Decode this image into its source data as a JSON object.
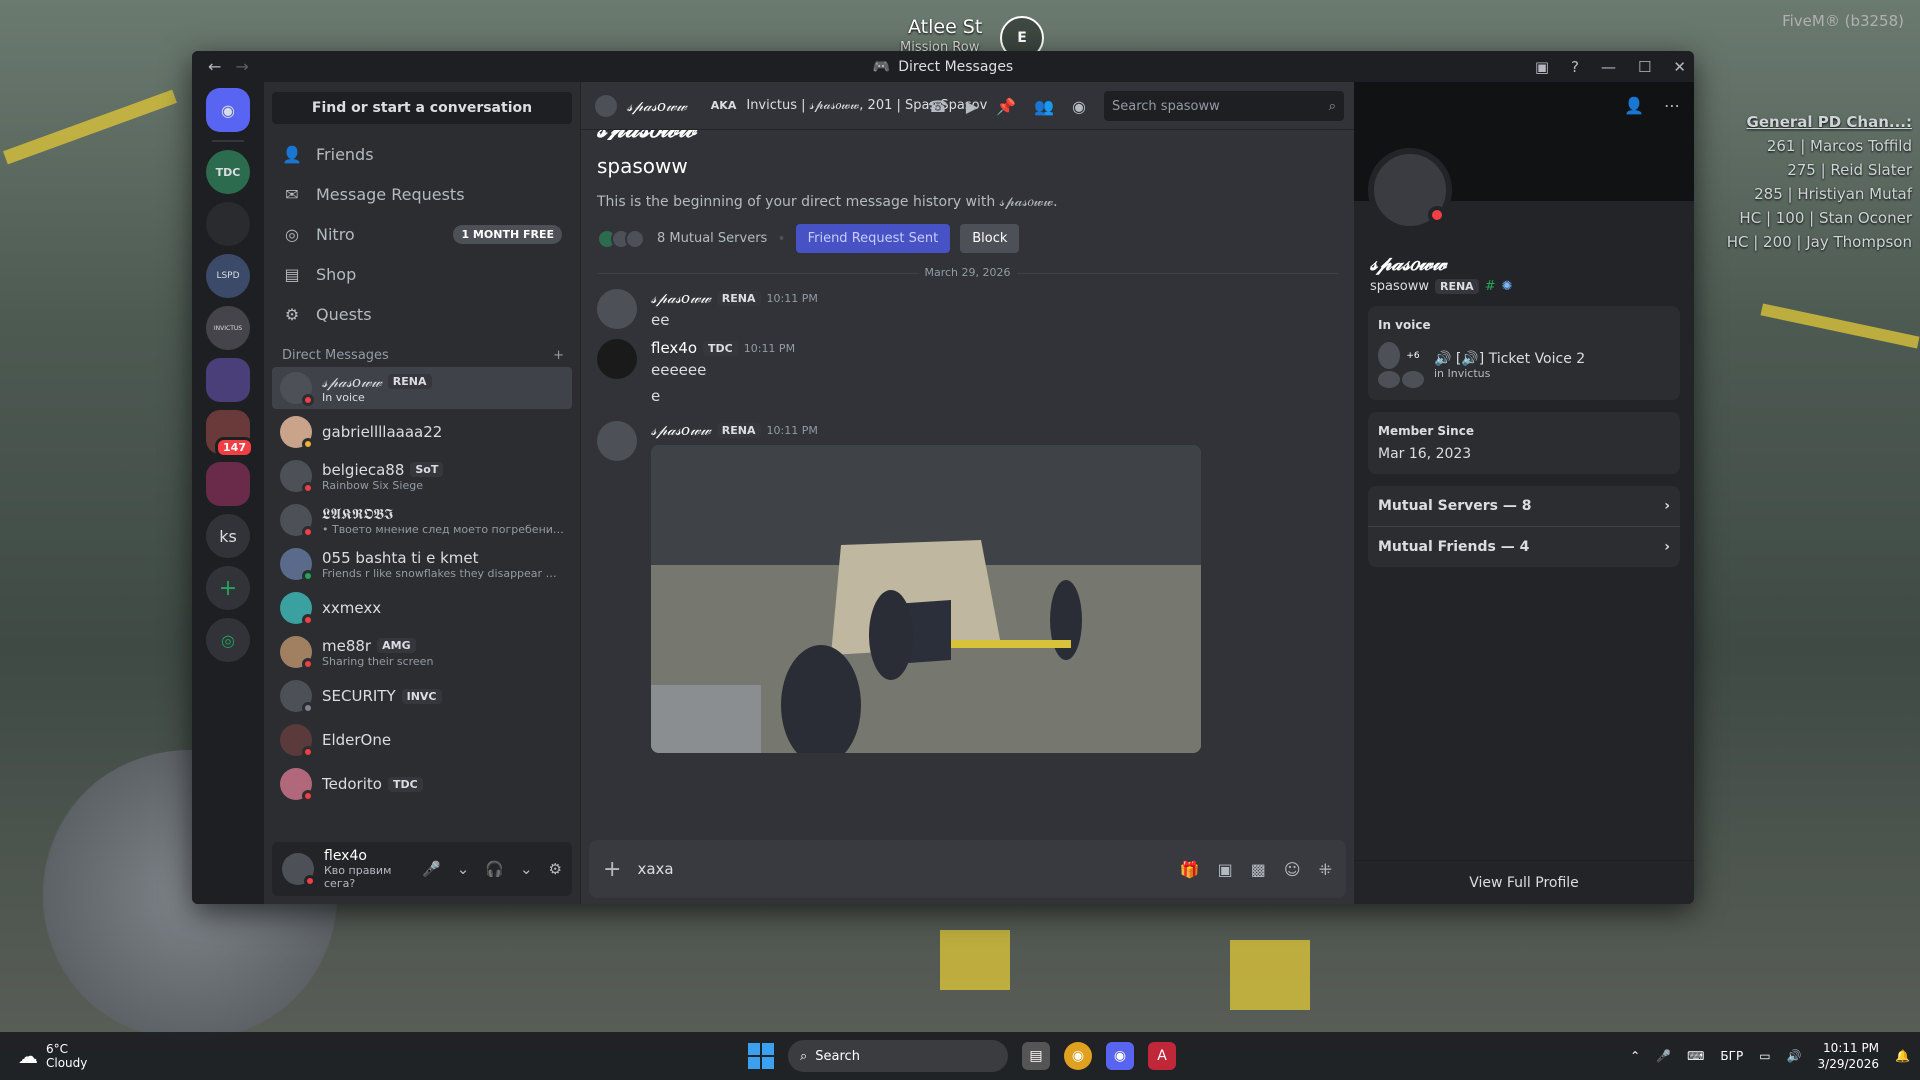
{
  "window": {
    "title": "Direct Messages"
  },
  "game": {
    "street": "Atlee St",
    "area": "Mission Row",
    "compass": "E",
    "client": "FiveM® (b3258)",
    "list_title": "General PD Chan...:",
    "list": [
      "261 | Marcos Toffild",
      "275 | Reid Slater",
      "285 | Hristiyan Mutaf",
      "HC | 100 | Stan Oconer",
      "HC | 200 | Jay Thompson"
    ]
  },
  "rail": {
    "ks": "ks",
    "badge": "147",
    "servers": [
      "TDC",
      "",
      "LSPD",
      "INVICTUS",
      "",
      "",
      ""
    ]
  },
  "sidebar": {
    "find": "Find or start a conversation",
    "nav": [
      {
        "label": "Friends",
        "icon": "person-wave-icon"
      },
      {
        "label": "Message Requests",
        "icon": "envelope-icon"
      },
      {
        "label": "Nitro",
        "icon": "nitro-icon",
        "tag": "1 MONTH FREE"
      },
      {
        "label": "Shop",
        "icon": "shop-icon"
      },
      {
        "label": "Quests",
        "icon": "quests-icon"
      }
    ],
    "dm_header": "Direct Messages",
    "dms": [
      {
        "name": "𝓈𝓅𝒶𝓈𝑜𝓌𝓌",
        "tag": "RENA",
        "sub": "In voice",
        "status": "dnd"
      },
      {
        "name": "gabriellllaaaa22",
        "tag": "",
        "sub": "",
        "status": "idle"
      },
      {
        "name": "belgieca88",
        "tag": "SoT",
        "sub": "Rainbow Six Siege",
        "status": "dnd"
      },
      {
        "name": "𝕷𝕬𝕶𝕽𝕺𝕭𝕴",
        "tag": "",
        "sub": "• Твоето мнение след моето погребение ...",
        "status": "dnd"
      },
      {
        "name": "055 bashta ti e kmet",
        "tag": "",
        "sub": "Friends r like snowflakes they disappear when ...",
        "status": "on"
      },
      {
        "name": "xxmexx",
        "tag": "",
        "sub": "",
        "status": "dnd"
      },
      {
        "name": "me88r",
        "tag": "AMG",
        "sub": "Sharing their screen",
        "status": "dnd"
      },
      {
        "name": "SECURITY",
        "tag": "INVC",
        "sub": "",
        "status": "off"
      },
      {
        "name": "ElderOne",
        "tag": "",
        "sub": "",
        "status": "dnd"
      },
      {
        "name": "Tedorito",
        "tag": "TDC",
        "sub": "",
        "status": "dnd"
      }
    ],
    "user": {
      "name": "flex4o",
      "status": "Кво правим сега?"
    }
  },
  "chat": {
    "header_name": "𝓈𝓅𝒶𝓈𝑜𝓌𝓌",
    "aka": "AKA",
    "aka_value": "Invictus | 𝓈𝓅𝒶𝓈𝑜𝓌𝓌, 201 | Spas Spasov",
    "search_placeholder": "Search spasoww",
    "intro_big": "𝓈𝓅𝒶𝓈𝑜𝓌𝓌",
    "intro_user": "spasoww",
    "intro_desc": "This is the beginning of your direct message history with 𝓈𝓅𝒶𝓈𝑜𝓌𝓌.",
    "mutual_servers": "8 Mutual Servers",
    "friend_sent": "Friend Request Sent",
    "block": "Block",
    "date": "March 29, 2026",
    "messages": [
      {
        "author": "𝓈𝓅𝒶𝓈𝑜𝓌𝓌",
        "tag": "RENA",
        "time": "10:11 PM",
        "lines": [
          "ee"
        ]
      },
      {
        "author": "flex4o",
        "tag": "TDC",
        "time": "10:11 PM",
        "lines": [
          "eeeeee",
          "e"
        ]
      },
      {
        "author": "𝓈𝓅𝒶𝓈𝑜𝓌𝓌",
        "tag": "RENA",
        "time": "10:11 PM",
        "lines": []
      }
    ],
    "composer_value": "xaxa"
  },
  "profile": {
    "display": "𝓈𝓅𝒶𝓈𝑜𝓌𝓌",
    "username": "spasoww",
    "tag": "RENA",
    "in_voice_label": "In voice",
    "voice_more": "+6",
    "voice_channel": "[🔊] Ticket Voice 2",
    "voice_server": "in Invictus",
    "member_since_label": "Member Since",
    "member_since": "Mar 16, 2023",
    "mutual_servers": "Mutual Servers — 8",
    "mutual_friends": "Mutual Friends — 4",
    "full_profile": "View Full Profile"
  },
  "taskbar": {
    "temp": "6°C",
    "weather": "Cloudy",
    "search": "Search",
    "lang": "БГР",
    "time": "10:11 PM",
    "date": "3/29/2026"
  }
}
